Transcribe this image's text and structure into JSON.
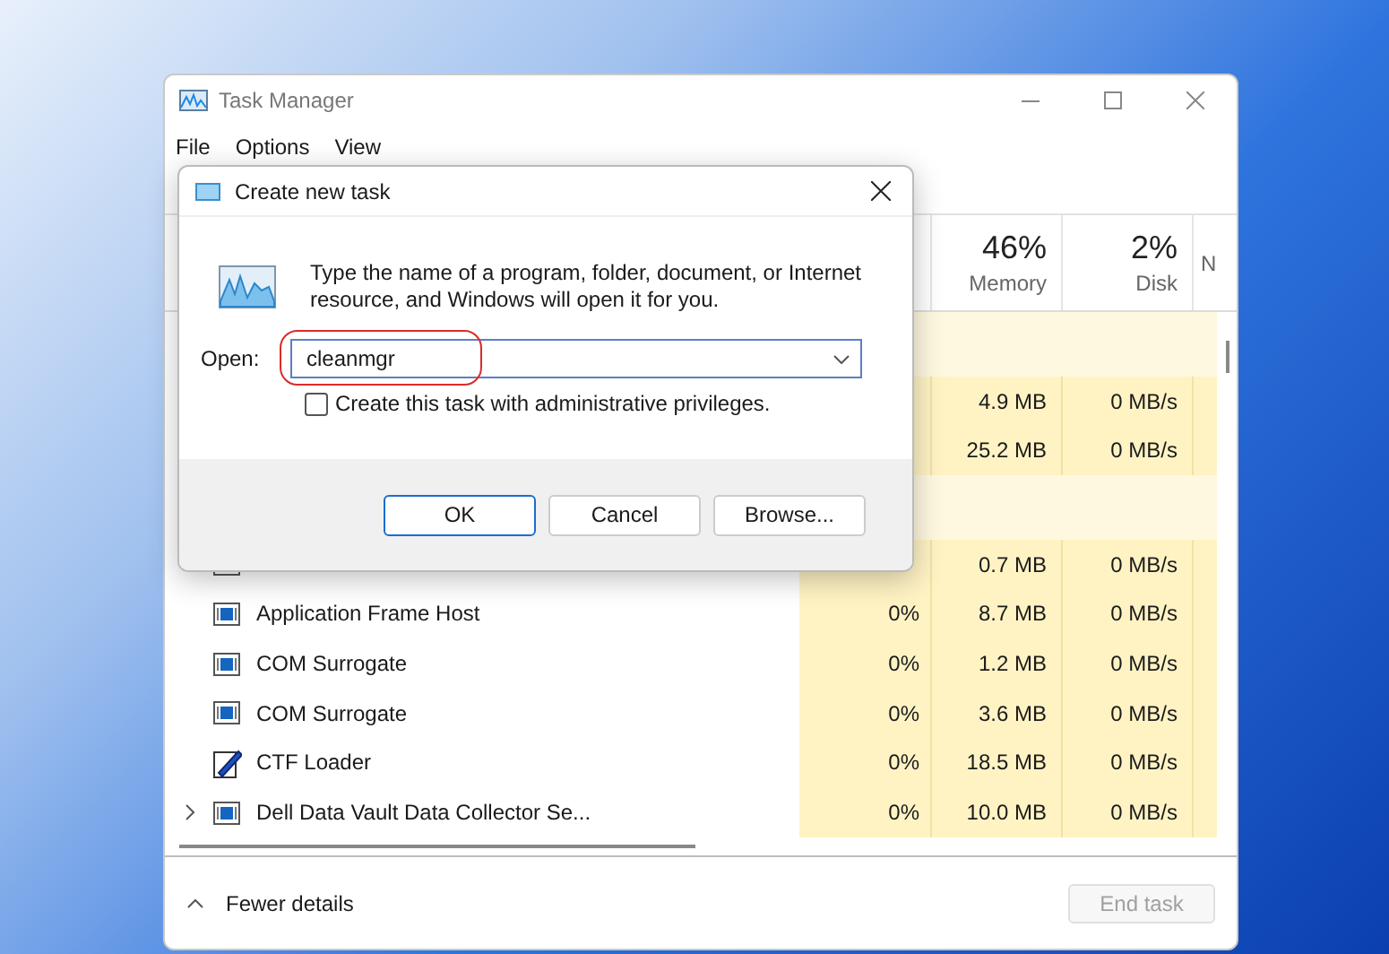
{
  "window": {
    "title": "Task Manager"
  },
  "menu": [
    "File",
    "Options",
    "View"
  ],
  "columns": [
    {
      "percent": "46%",
      "label": "Memory"
    },
    {
      "percent": "2%",
      "label": "Disk"
    },
    {
      "label": "N"
    }
  ],
  "rows": [
    {
      "kind": "group"
    },
    {
      "kind": "app",
      "memory": "4.9 MB",
      "disk": "0 MB/s"
    },
    {
      "kind": "app",
      "memory": "25.2 MB",
      "disk": "0 MB/s"
    },
    {
      "kind": "group"
    },
    {
      "kind": "app",
      "memory": "0.7 MB",
      "disk": "0 MB/s"
    },
    {
      "kind": "app",
      "expandable": false,
      "name": "Application Frame Host",
      "cpu": "0%",
      "memory": "8.7 MB",
      "disk": "0 MB/s"
    },
    {
      "kind": "app",
      "expandable": false,
      "name": "COM Surrogate",
      "cpu": "0%",
      "memory": "1.2 MB",
      "disk": "0 MB/s"
    },
    {
      "kind": "app",
      "expandable": false,
      "name": "COM Surrogate",
      "cpu": "0%",
      "memory": "3.6 MB",
      "disk": "0 MB/s"
    },
    {
      "kind": "tool",
      "expandable": false,
      "name": "CTF Loader",
      "cpu": "0%",
      "memory": "18.5 MB",
      "disk": "0 MB/s"
    },
    {
      "kind": "app",
      "expandable": true,
      "name": "Dell Data Vault Data Collector Se...",
      "cpu": "0%",
      "memory": "10.0 MB",
      "disk": "0 MB/s"
    }
  ],
  "footer": {
    "toggle": "Fewer details",
    "end_task": {
      "label": "End task",
      "disabled": true
    }
  },
  "dialog": {
    "title": "Create new task",
    "message": "Type the name of a program, folder, document, or Internet resource, and Windows will open it for you.",
    "open_label": "Open:",
    "open_value": "cleanmgr",
    "admin_checkbox": {
      "label": "Create this task with administrative privileges.",
      "checked": false
    },
    "buttons": [
      {
        "label": "OK",
        "default": true
      },
      {
        "label": "Cancel",
        "default": false
      },
      {
        "label": "Browse...",
        "default": false
      }
    ]
  }
}
